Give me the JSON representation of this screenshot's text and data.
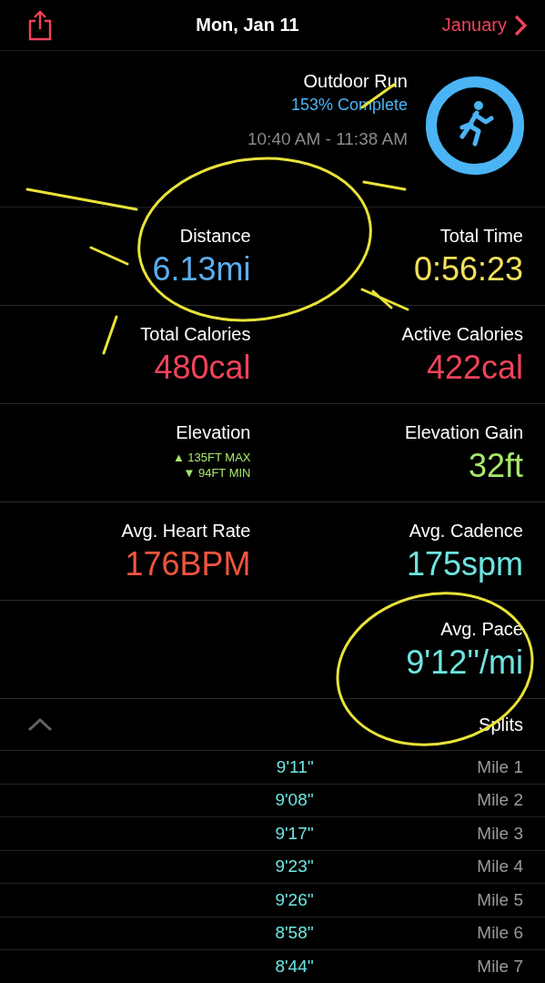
{
  "nav": {
    "back": "January",
    "title": "Mon, Jan 11"
  },
  "workout": {
    "name": "Outdoor Run",
    "progress": "153% Complete",
    "time": "10:40 AM - 11:38 AM",
    "level": 1
  },
  "metrics": [
    [
      {
        "kind": "value",
        "label": "Distance",
        "value": "6.13mi",
        "color": "#5aaef0"
      },
      {
        "kind": "value",
        "label": "Total Time",
        "value": "0:56:23",
        "color": "#f2e05a"
      }
    ],
    [
      {
        "kind": "value",
        "label": "Total Calories",
        "value": "480cal",
        "color": "#f0435a"
      },
      {
        "kind": "value",
        "label": "Active Calories",
        "value": "422cal",
        "color": "#f0435a"
      }
    ],
    [
      {
        "kind": "range",
        "label": "Elevation",
        "max": "▲ 135FT MAX",
        "min": "▼ 94FT MIN",
        "color": "#a6e86c"
      },
      {
        "kind": "value",
        "label": "Elevation Gain",
        "value": "32ft",
        "color": "#a6e86c"
      }
    ],
    [
      {
        "kind": "value",
        "label": "Avg. Heart Rate",
        "value": "176BPM",
        "color": "#f0553f"
      },
      {
        "kind": "value",
        "label": "Avg. Cadence",
        "value": "175spm",
        "color": "#6ee4e0"
      }
    ],
    [
      {
        "kind": "value",
        "label": "Avg. Pace",
        "value": "9'12''/mi",
        "color": "#6ee4e0"
      }
    ]
  ],
  "splits": {
    "title": "Splits",
    "expanded": true,
    "rows": [
      {
        "mile": "Mile 1",
        "pace": "9'11''"
      },
      {
        "mile": "Mile 2",
        "pace": "9'08''"
      },
      {
        "mile": "Mile 3",
        "pace": "9'17''"
      },
      {
        "mile": "Mile 4",
        "pace": "9'23''"
      },
      {
        "mile": "Mile 5",
        "pace": "9'26''"
      },
      {
        "mile": "Mile 6",
        "pace": "8'58''"
      },
      {
        "mile": "Mile 7",
        "pace": "8'44''"
      }
    ]
  }
}
